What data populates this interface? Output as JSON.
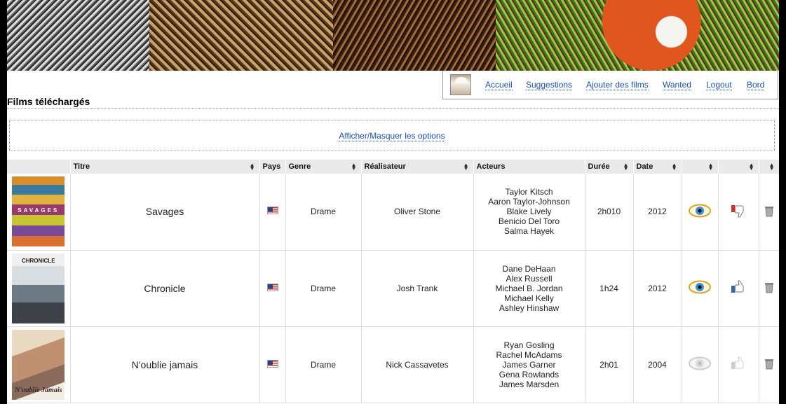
{
  "banner": {
    "segments": [
      "portrait-sketch",
      "embrace-painting",
      "pirates-painting",
      "mad-hatter-painting"
    ]
  },
  "nav": {
    "items": [
      {
        "label": "Accueil"
      },
      {
        "label": "Suggestions"
      },
      {
        "label": "Ajouter des films"
      },
      {
        "label": "Wanted"
      },
      {
        "label": "Logout"
      },
      {
        "label": "Bord"
      }
    ]
  },
  "page_title": "Films téléchargés",
  "options_link": "Afficher/Masquer les options",
  "table": {
    "headers": [
      "",
      "Titre",
      "Pays",
      "Genre",
      "Réalisateur",
      "Acteurs",
      "Durée",
      "Date",
      "",
      "",
      ""
    ],
    "rows": [
      {
        "poster_text": "SAVAGES",
        "title": "Savages",
        "country_icon": "us-flag-icon",
        "genre": "Drame",
        "director": "Oliver Stone",
        "actors": [
          "Taylor Kitsch",
          "Aaron Taylor-Johnson",
          "Blake Lively",
          "Benicio Del Toro",
          "Salma Hayek"
        ],
        "duration": "2h010",
        "date": "2012",
        "seen": true,
        "rating": "dislike",
        "trash_icon": "trash-icon"
      },
      {
        "poster_text": "CHRONICLE",
        "title": "Chronicle",
        "country_icon": "us-flag-icon",
        "genre": "Drame",
        "director": "Josh Trank",
        "actors": [
          "Dane DeHaan",
          "Alex Russell",
          "Michael B. Jordan",
          "Michael Kelly",
          "Ashley Hinshaw"
        ],
        "duration": "1h24",
        "date": "2012",
        "seen": true,
        "rating": "like",
        "trash_icon": "trash-icon"
      },
      {
        "poster_text": "N'oublie Jamais",
        "title": "N'oublie jamais",
        "country_icon": "us-flag-icon",
        "genre": "Drame",
        "director": "Nick Cassavetes",
        "actors": [
          "Ryan Gosling",
          "Rachel McAdams",
          "James Garner",
          "Gena Rowlands",
          "James Marsden"
        ],
        "duration": "2h01",
        "date": "2004",
        "seen": false,
        "rating": "none",
        "trash_icon": "trash-icon"
      }
    ]
  },
  "colors": {
    "link": "#1a4fb3",
    "eye_seen": "#e0a21a",
    "like": "#3b5fa8",
    "dislike": "#c9342a",
    "inactive": "#cccccc"
  }
}
